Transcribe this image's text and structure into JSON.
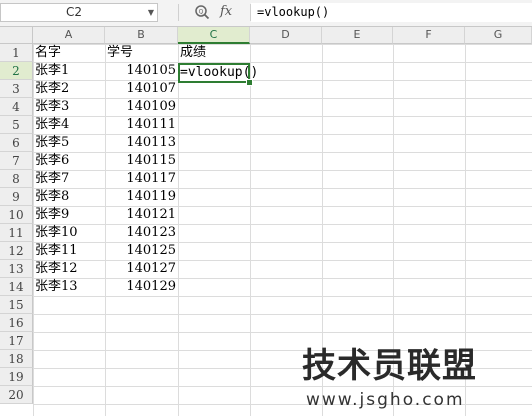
{
  "name_box": {
    "value": "C2"
  },
  "formula_bar": {
    "fx_label": "fx",
    "value": "=vlookup()"
  },
  "columns": [
    "A",
    "B",
    "C",
    "D",
    "E",
    "F",
    "G"
  ],
  "rows": [
    "1",
    "2",
    "3",
    "4",
    "5",
    "6",
    "7",
    "8",
    "9",
    "10",
    "11",
    "12",
    "13",
    "14",
    "15",
    "16",
    "17",
    "18",
    "19",
    "20"
  ],
  "active_cell": {
    "ref": "C2",
    "column": "C",
    "row": "2",
    "value": "=vlookup()"
  },
  "headers": {
    "a1": "名字",
    "b1": "学号",
    "c1": "成绩"
  },
  "data_rows": [
    {
      "name": "张李1",
      "id": "140105"
    },
    {
      "name": "张李2",
      "id": "140107"
    },
    {
      "name": "张李3",
      "id": "140109"
    },
    {
      "name": "张李4",
      "id": "140111"
    },
    {
      "name": "张李5",
      "id": "140113"
    },
    {
      "name": "张李6",
      "id": "140115"
    },
    {
      "name": "张李7",
      "id": "140117"
    },
    {
      "name": "张李8",
      "id": "140119"
    },
    {
      "name": "张李9",
      "id": "140121"
    },
    {
      "name": "张李10",
      "id": "140123"
    },
    {
      "name": "张李11",
      "id": "140125"
    },
    {
      "name": "张李12",
      "id": "140127"
    },
    {
      "name": "张李13",
      "id": "140129"
    }
  ],
  "watermark": {
    "title": "技术员联盟",
    "url": "www.jsgho.com"
  },
  "colors": {
    "accent": "#2e7d32",
    "header_bg": "#eeeeee",
    "active_header_bg": "#e1eccf",
    "gridline": "#dcdcdc"
  }
}
